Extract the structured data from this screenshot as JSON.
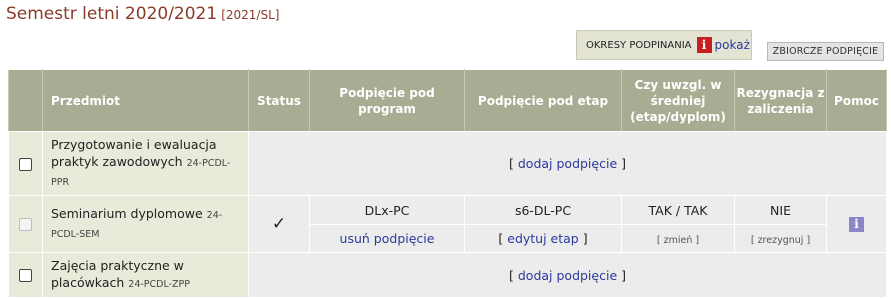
{
  "semester": {
    "title": "Semestr letni 2020/2021",
    "code": "[2021/SL]"
  },
  "okresy": {
    "label": "OKRESY PODPINANIA",
    "info_glyph": "i",
    "link": "pokaż"
  },
  "zbiorcze_button": "ZBIORCZE PODPIĘCIE",
  "table": {
    "headers": {
      "przedmiot": "Przedmiot",
      "status": "Status",
      "program": "Podpięcie pod program",
      "etap": "Podpięcie pod etap",
      "srednia": "Czy uwzgl. w średniej (etap/dyplom)",
      "rezygnacja": "Rezygnacja z zaliczenia",
      "pomoc": "Pomoc"
    },
    "rows": [
      {
        "name": "Przygotowanie i ewaluacja praktyk zawodowych",
        "code": "24-PCDL-PPR",
        "action_open": "[",
        "action": "dodaj podpięcie",
        "action_close": "]"
      },
      {
        "name": "Seminarium dyplomowe",
        "code": "24-PCDL-SEM",
        "status": "✓",
        "program": "DLx-PC",
        "etap": "s6-DL-PC",
        "srednia": "TAK / TAK",
        "rezygnacja": "NIE",
        "remove": "usuń podpięcie",
        "edit_open": "[",
        "edit": "edytuj etap",
        "edit_close": "]",
        "zmien": "[ zmień ]",
        "zrezygnuj": "[ zrezygnuj ]",
        "help_glyph": "i"
      },
      {
        "name": "Zajęcia praktyczne w placówkach",
        "code": "24-PCDL-ZPP",
        "action_open": "[",
        "action": "dodaj podpięcie",
        "action_close": "]"
      }
    ]
  }
}
